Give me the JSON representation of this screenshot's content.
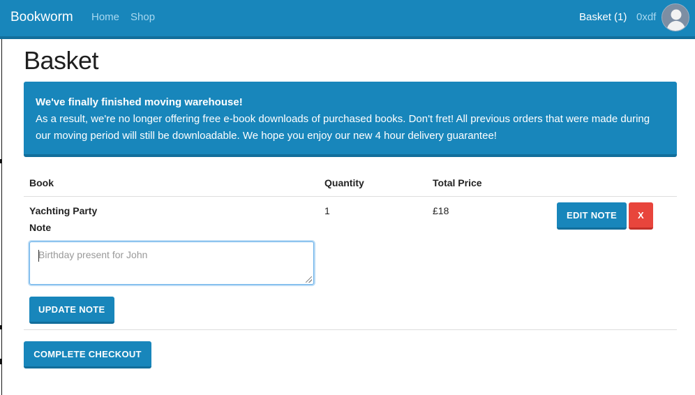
{
  "navbar": {
    "brand": "Bookworm",
    "links": [
      "Home",
      "Shop"
    ],
    "basket": "Basket (1)",
    "user": "0xdf",
    "avatar_icon": "user-avatar-icon"
  },
  "page": {
    "title": "Basket"
  },
  "alert": {
    "title": "We've finally finished moving warehouse!",
    "line1": "As a result, we're no longer offering free e-book downloads of purchased books. Don't fret! All previous orders that were made during",
    "line2": "our moving period will still be downloadable. We hope you enjoy our new 4 hour delivery guarantee!"
  },
  "table": {
    "headers": {
      "book": "Book",
      "quantity": "Quantity",
      "total_price": "Total Price"
    },
    "rows": [
      {
        "book": "Yachting Party",
        "note_label": "Note",
        "note_placeholder": "Birthday present for John",
        "quantity": "1",
        "total_price": "£18",
        "edit_note_label": "EDIT NOTE",
        "remove_label": "X",
        "update_note_label": "UPDATE NOTE"
      }
    ]
  },
  "checkout": {
    "label": "COMPLETE CHECKOUT"
  },
  "colors": {
    "primary": "#1886bb",
    "primary_dark": "#126e9b",
    "danger": "#e8453c"
  }
}
